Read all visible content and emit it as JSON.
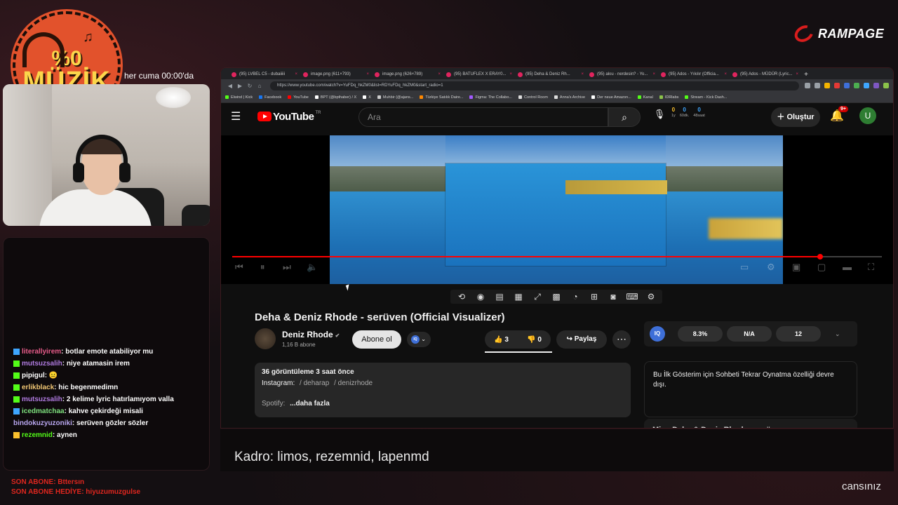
{
  "overlay": {
    "logo_top": "%0",
    "logo_main": "MÜZİK",
    "schedule": "her cuma 00:00'da",
    "brand": "RAMPAGE",
    "signature": "cansınız",
    "last_sub": "SON ABONE: Bttersın",
    "last_gift": "SON ABONE HEDİYE: hiyuzumuzgulse",
    "caption": "Kadro: limos, rezemnid, lapenmd"
  },
  "chat": [
    {
      "user": "literallyirem",
      "msg": ": botlar emote atabiliyor mu",
      "color": "#e85c8a",
      "badge": "#3ea6ff"
    },
    {
      "user": "mutsuzsalih",
      "msg": ": niye atamasin irem",
      "color": "#b07be0",
      "badge": "#53fc18"
    },
    {
      "user": "pipigul",
      "msg": ": 😐",
      "color": "#ffffff",
      "badge": "#53fc18"
    },
    {
      "user": "erlikblack",
      "msg": ": hic begenmedimn",
      "color": "#f0c674",
      "badge": "#53fc18"
    },
    {
      "user": "mutsuzsalih",
      "msg": ": 2 kelime lyric hatırlamıyom valla",
      "color": "#b07be0",
      "badge": "#53fc18"
    },
    {
      "user": "icedmatchaa",
      "msg": ": kahve çekirdeği misali",
      "color": "#7ee07e",
      "badge": "#3ea6ff"
    },
    {
      "user": "bindokuzyuzoniki",
      "msg": ": serüven gözler sözler",
      "color": "#b9a7f0",
      "badge": ""
    },
    {
      "user": "rezemnid",
      "msg": ": aynen",
      "color": "#53fc18",
      "badge": "#fbc02d"
    }
  ],
  "browser": {
    "tabs": [
      "(95) LVBEL C5 - dubaiiiii",
      "image.png (611×793)",
      "image.png (626×789)",
      "(95) BATUFLEX X ERAY0...",
      "(95) Deha & Deniz Rh...",
      "(95) akıu - nerdesin? - Yo...",
      "(95) Ados - Yıkılır (Officia...",
      "(95) Ados - MÜDÜR (Lyric..."
    ],
    "new_tab": "+",
    "url": "https://www.youtube.com/watch?v=YuFDq_hkZM0&list=RDYuFDq_hkZM0&start_radio=1",
    "bookmarks": [
      {
        "label": "Elwind | Kick",
        "color": "#53fc18"
      },
      {
        "label": "Facebook",
        "color": "#1877f2"
      },
      {
        "label": "YouTube",
        "color": "#ff0000"
      },
      {
        "label": "BPT (@bpthaber) / X",
        "color": "#ffffff"
      },
      {
        "label": "X",
        "color": "#ffffff"
      },
      {
        "label": "Muhbir (@ajans...",
        "color": "#cccccc"
      },
      {
        "label": "Türkiye Satılık Daire...",
        "color": "#ff8800"
      },
      {
        "label": "Figma: The Collabo...",
        "color": "#a259ff"
      },
      {
        "label": "Control Room",
        "color": "#dddddd"
      },
      {
        "label": "Anna's Archive",
        "color": "#dddddd"
      },
      {
        "label": "Der neue Amazon...",
        "color": "#ffffff"
      },
      {
        "label": "Kanal",
        "color": "#53fc18"
      },
      {
        "label": "IDRlabs",
        "color": "#8bc34a"
      },
      {
        "label": "Stream - Kick Dash...",
        "color": "#53fc18"
      }
    ]
  },
  "youtube": {
    "logo": "YouTube",
    "region": "TR",
    "search_placeholder": "Ara",
    "stats": [
      {
        "value": "0",
        "label": "1y",
        "accent": "#fbc02d"
      },
      {
        "value": "0",
        "label": "60dk.",
        "accent": "#3ea6ff"
      },
      {
        "value": "0",
        "label": "48saat",
        "accent": "#3ea6ff"
      }
    ],
    "create": "Oluştur",
    "notif_count": "9+",
    "avatar": "U",
    "progress": 0.905,
    "title": "Deha & Deniz Rhode - serüven (Official Visualizer)",
    "channel": "Deniz Rhode",
    "subs": "1,16 B abone",
    "subscribe": "Abone ol",
    "iq": "IQ",
    "likes": "3",
    "dislikes": "0",
    "share": "Paylaş",
    "desc_stats": "36 görüntüleme  3 saat önce",
    "desc_instagram_label": "Instagram:",
    "desc_tag1": "/ deharap",
    "desc_tag2": "/ denizrhode",
    "desc_spotify": "Spotify:",
    "desc_more": "...daha fazla",
    "iq_panel": [
      "8.3%",
      "N/A",
      "12"
    ],
    "replay_note": "Bu İlk Gösterim için Sohbeti Tekrar Oynatma özelliği devre dışı.",
    "mix_title": "Mix - Deha & Deniz Rhode - serüven"
  }
}
